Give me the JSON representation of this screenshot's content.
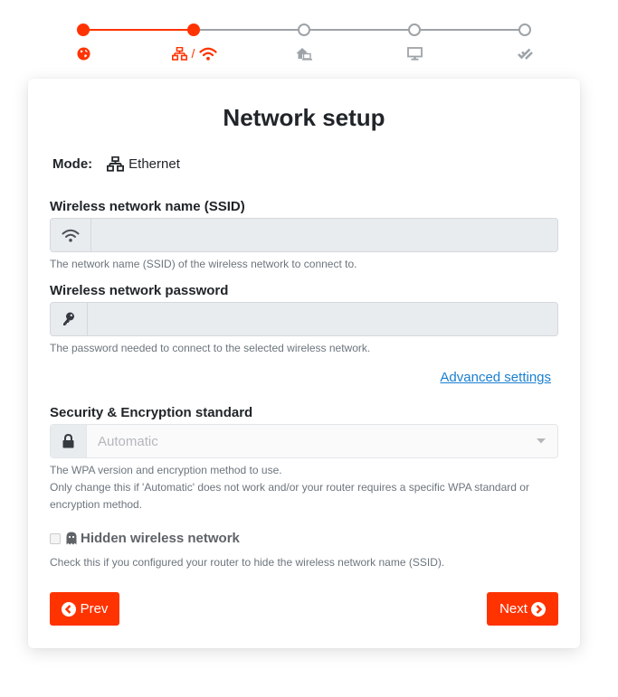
{
  "stepper": {
    "current_step": 2,
    "total_steps": 5,
    "steps": [
      {
        "name": "region",
        "icon": "globe-icon",
        "status": "done"
      },
      {
        "name": "network",
        "icon": "ethernet-or-wifi-icon",
        "separator": "/",
        "status": "current"
      },
      {
        "name": "home",
        "icon": "home-laptop-icon",
        "status": "pending"
      },
      {
        "name": "display",
        "icon": "desktop-icon",
        "status": "pending"
      },
      {
        "name": "finish",
        "icon": "double-check-icon",
        "status": "pending"
      }
    ],
    "colors": {
      "active": "#ff3300",
      "inactive": "#9ea3a8"
    }
  },
  "card": {
    "title": "Network setup",
    "mode": {
      "label": "Mode:",
      "icon": "ethernet-icon",
      "value": "Ethernet"
    },
    "ssid": {
      "label": "Wireless network name (SSID)",
      "icon": "wifi-icon",
      "value": "",
      "placeholder": "",
      "help": "The network name (SSID) of the wireless network to connect to."
    },
    "password": {
      "label": "Wireless network password",
      "icon": "key-icon",
      "value": "",
      "placeholder": "",
      "help": "The password needed to connect to the selected wireless network."
    },
    "advanced_link": "Advanced settings",
    "security": {
      "label": "Security & Encryption standard",
      "icon": "lock-icon",
      "selected": "Automatic",
      "help_line1": "The WPA version and encryption method to use.",
      "help_line2": "Only change this if 'Automatic' does not work and/or your router requires a specific WPA standard or encryption method."
    },
    "hidden_network": {
      "label": "Hidden wireless network",
      "icon": "ghost-icon",
      "checked": false,
      "help": "Check this if you configured your router to hide the wireless network name (SSID)."
    },
    "buttons": {
      "prev": "Prev",
      "next": "Next"
    },
    "accent_color": "#ff3300",
    "link_color": "#1a7fd0"
  }
}
